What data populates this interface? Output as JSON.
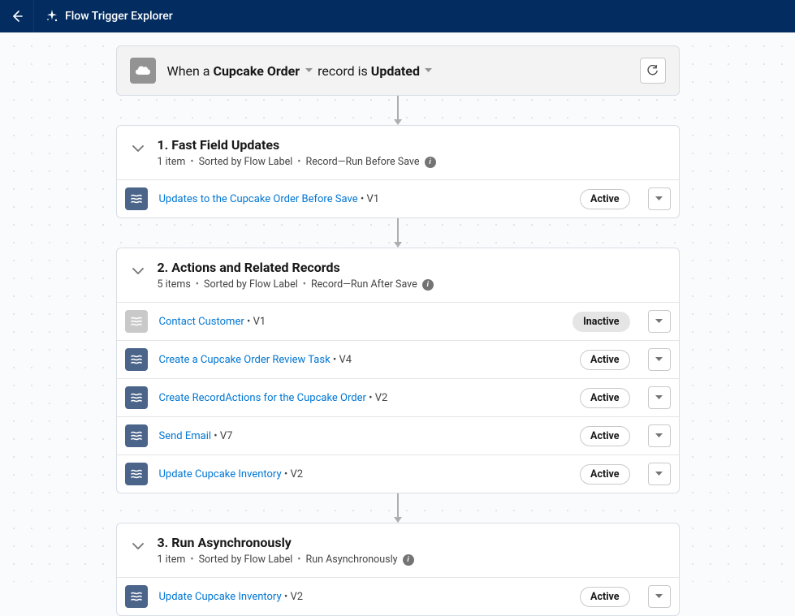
{
  "topbar": {
    "title": "Flow Trigger Explorer"
  },
  "trigger": {
    "prefix": "When a",
    "object": "Cupcake Order",
    "mid": "record is",
    "event": "Updated"
  },
  "sections": [
    {
      "title": "1. Fast Field Updates",
      "count": "1 item",
      "sort": "Sorted by Flow Label",
      "context": "Record—Run Before Save",
      "flows": [
        {
          "label": "Updates to the Cupcake Order Before Save",
          "version": "V1",
          "status": "Active"
        }
      ]
    },
    {
      "title": "2. Actions and Related Records",
      "count": "5 items",
      "sort": "Sorted by Flow Label",
      "context": "Record—Run After Save",
      "flows": [
        {
          "label": "Contact Customer",
          "version": "V1",
          "status": "Inactive"
        },
        {
          "label": "Create a Cupcake Order Review Task",
          "version": "V4",
          "status": "Active"
        },
        {
          "label": "Create RecordActions for the Cupcake Order",
          "version": "V2",
          "status": "Active"
        },
        {
          "label": "Send Email",
          "version": "V7",
          "status": "Active"
        },
        {
          "label": "Update Cupcake Inventory",
          "version": "V2",
          "status": "Active"
        }
      ]
    },
    {
      "title": "3. Run Asynchronously",
      "count": "1 item",
      "sort": "Sorted by Flow Label",
      "context": "Run Asynchronously",
      "flows": [
        {
          "label": "Update Cupcake Inventory",
          "version": "V2",
          "status": "Active"
        }
      ]
    }
  ]
}
